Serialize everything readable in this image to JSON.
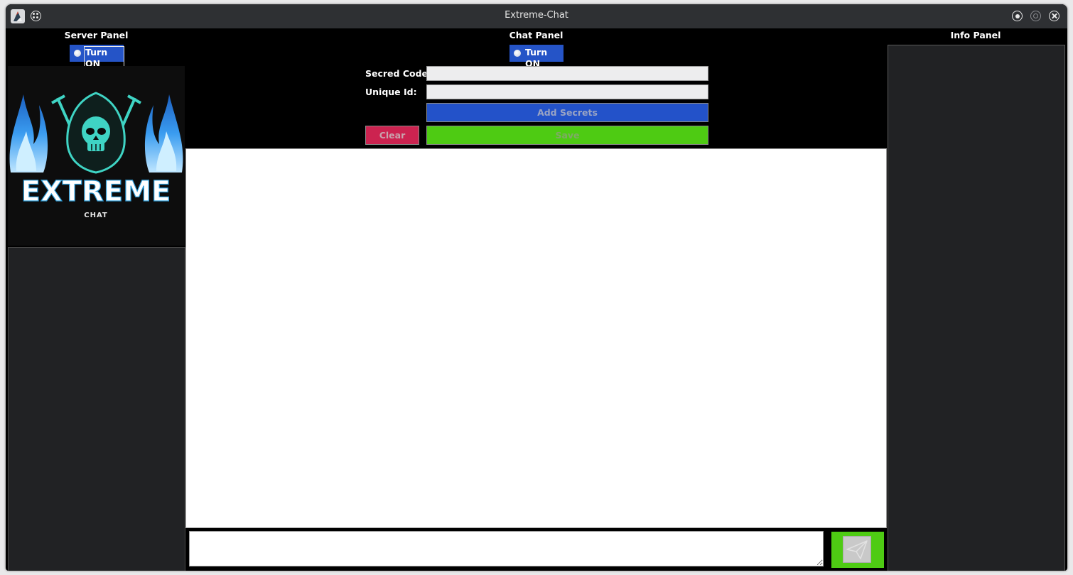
{
  "window": {
    "title": "Extreme-Chat",
    "icons": [
      "app-icon",
      "menu-icon",
      "minimize-icon",
      "maximize-icon",
      "close-icon"
    ]
  },
  "server_panel": {
    "title": "Server Panel",
    "toggle_label": "Turn ON",
    "logo": {
      "main_text": "EXTREME",
      "sub_text": "CHAT"
    }
  },
  "chat_panel": {
    "title": "Chat Panel",
    "toggle_label": "Turn ON",
    "secret_code_label": "Secred Code:",
    "secret_code_value": "",
    "unique_id_label": "Unique Id:",
    "unique_id_value": "",
    "add_secrets_label": "Add Secrets",
    "clear_label": "Clear",
    "save_label": "Save",
    "message_value": "",
    "send_icon": "paper-plane-icon"
  },
  "info_panel": {
    "title": "Info Panel"
  },
  "colors": {
    "toggle": "#2554c7",
    "add_secrets": "#2352c9",
    "clear": "#cc2350",
    "save": "#4ecb13",
    "send": "#4ecb13"
  }
}
